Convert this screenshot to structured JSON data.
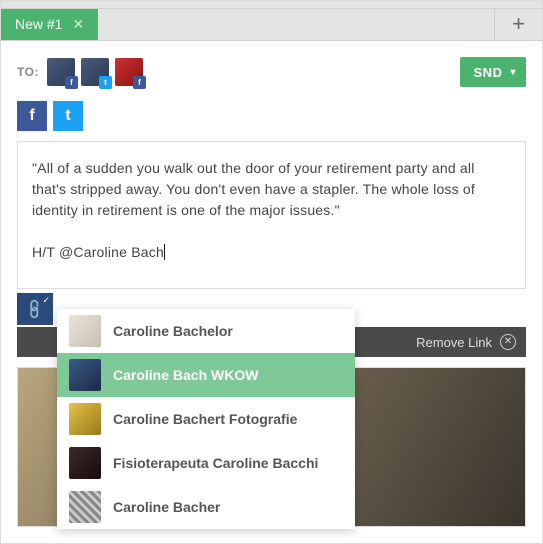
{
  "tab": {
    "label": "New #1"
  },
  "to": {
    "label": "TO:"
  },
  "send_button": {
    "label": "SND"
  },
  "compose": {
    "body": "\"All of a sudden you walk out the door of your retirement party and all that's stripped away.  You don't even have a stapler.  The whole loss of identity in retirement is one of the major issues.\"",
    "ht_line": "H/T @Caroline Bach"
  },
  "remove_link": {
    "label": "Remove Link"
  },
  "autocomplete": {
    "items": [
      {
        "label": "Caroline Bachelor",
        "selected": false
      },
      {
        "label": "Caroline Bach WKOW",
        "selected": true
      },
      {
        "label": "Caroline Bachert Fotografie",
        "selected": false
      },
      {
        "label": "Fisioterapeuta Caroline Bacchi",
        "selected": false
      },
      {
        "label": "Caroline Bacher",
        "selected": false
      }
    ]
  }
}
